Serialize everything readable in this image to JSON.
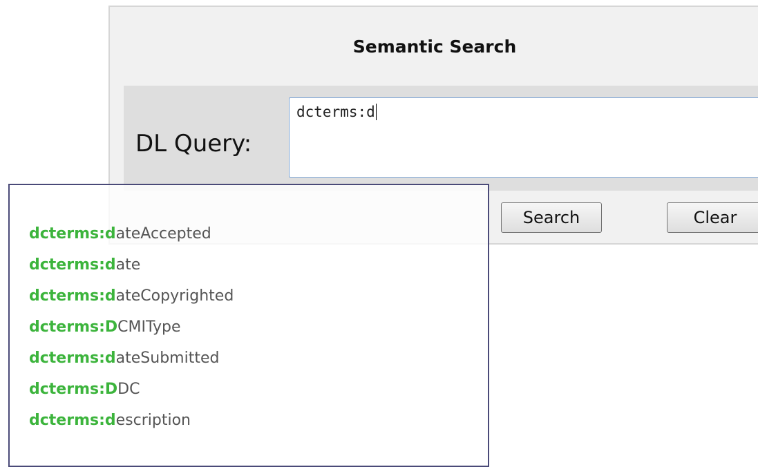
{
  "panel": {
    "title": "Semantic Search",
    "query_label": "DL Query:",
    "query_value": "dcterms:d",
    "search_label": "Search",
    "clear_label": "Clear"
  },
  "suggestions": [
    {
      "match": "dcterms:d",
      "rest": "ateAccepted"
    },
    {
      "match": "dcterms:d",
      "rest": "ate"
    },
    {
      "match": "dcterms:d",
      "rest": "ateCopyrighted"
    },
    {
      "match": "dcterms:D",
      "rest": "CMIType"
    },
    {
      "match": "dcterms:d",
      "rest": "ateSubmitted"
    },
    {
      "match": "dcterms:D",
      "rest": "DC"
    },
    {
      "match": "dcterms:d",
      "rest": "escription"
    }
  ],
  "colors": {
    "match_highlight": "#3cb43c",
    "popup_border": "#4a4a78",
    "input_border": "#7ea6d6"
  }
}
